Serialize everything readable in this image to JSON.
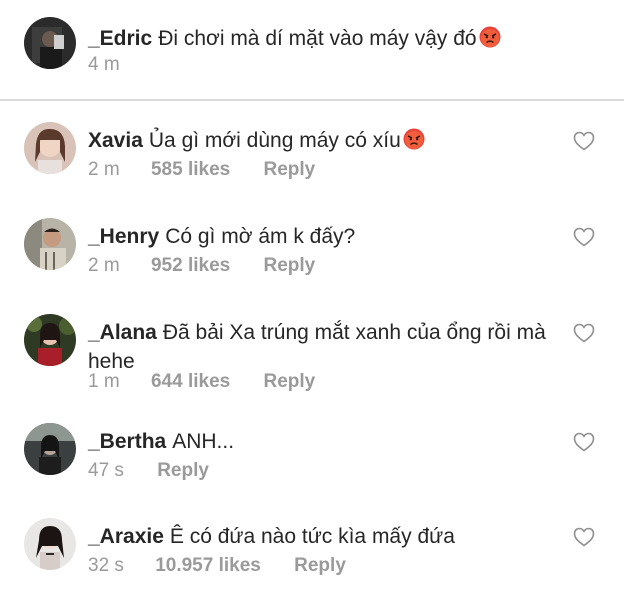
{
  "post": {
    "username": "_Edric",
    "text": "Đi chơi mà dí mặt vào máy vậy đó",
    "emoji": "angry-face-emoji",
    "time": "4 m"
  },
  "comments": [
    {
      "username": "Xavia",
      "text": "Ủa gì mới dùng máy có xíu",
      "emoji": "angry-face-emoji",
      "time": "2 m",
      "likes": "585 likes",
      "reply": "Reply"
    },
    {
      "username": "_Henry",
      "text": "Có gì mờ ám k đấy?",
      "time": "2 m",
      "likes": "952 likes",
      "reply": "Reply"
    },
    {
      "username": "_Alana",
      "text": "Đã bải Xa trúng mắt xanh của ổng rồi mà hehe",
      "time": "1 m",
      "likes": "644 likes",
      "reply": "Reply"
    },
    {
      "username": "_Bertha",
      "text": "ANH...",
      "time": "47 s",
      "likes": "",
      "reply": "Reply"
    },
    {
      "username": "_Araxie",
      "text": "Ê có đứa nào tức kìa mấy đứa",
      "time": "32 s",
      "likes": "10.957 likes",
      "reply": "Reply"
    }
  ],
  "colors": {
    "text": "#262626",
    "meta": "#9a9a9a",
    "divider": "#dbdbdb",
    "heart_outline": "#8e8e8e"
  },
  "icons": {
    "like": "heart-outline-icon"
  }
}
